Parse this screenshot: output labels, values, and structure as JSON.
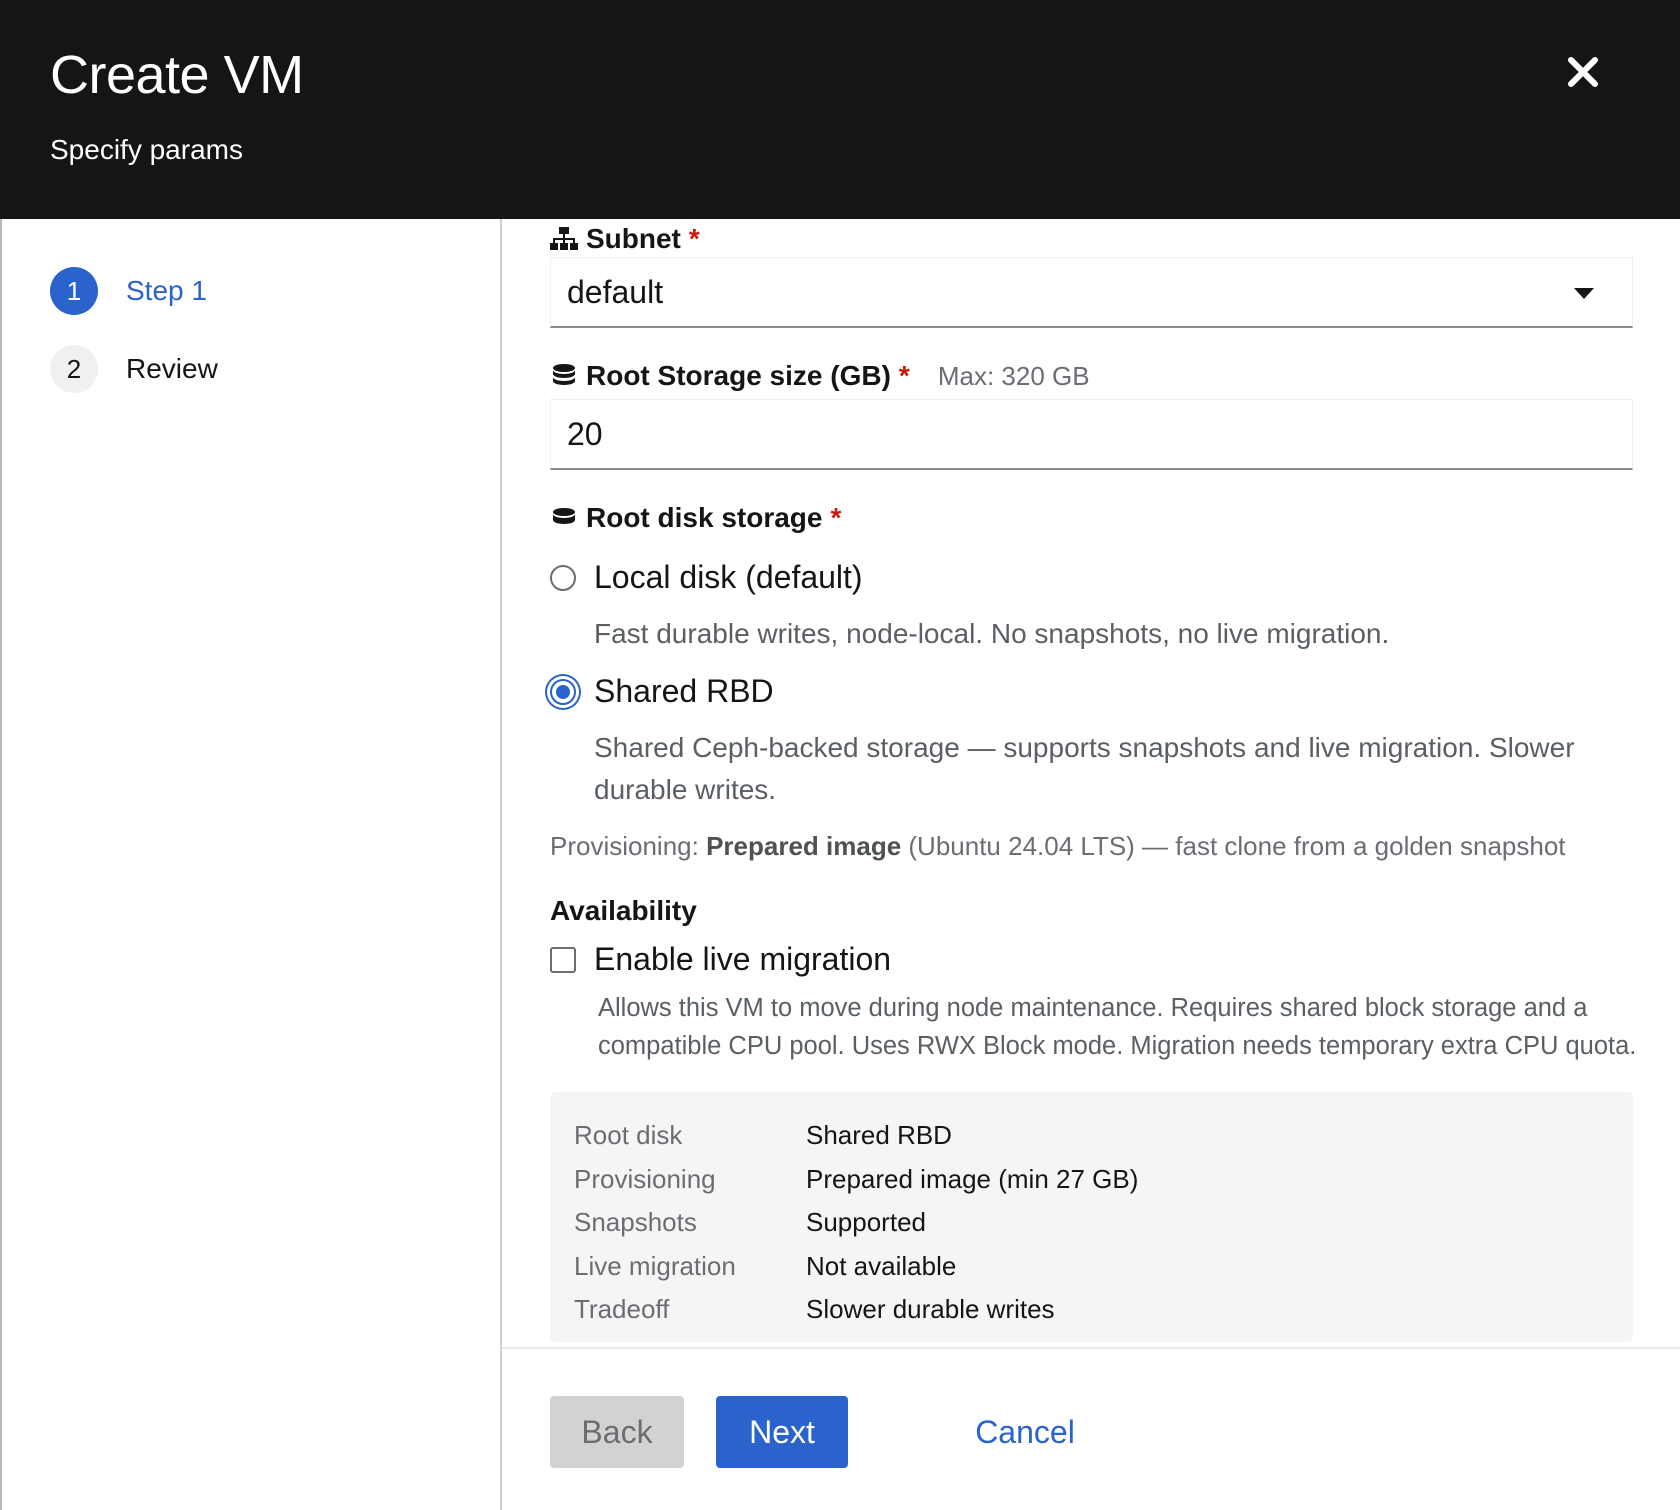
{
  "header": {
    "title": "Create VM",
    "subtitle": "Specify params",
    "close_icon": "close-icon"
  },
  "wizard_nav": {
    "steps": [
      {
        "number": "1",
        "label": "Step 1",
        "state": "active"
      },
      {
        "number": "2",
        "label": "Review",
        "state": "idle"
      }
    ]
  },
  "form": {
    "subnet": {
      "label": "Subnet",
      "required_mark": "*",
      "icon": "network-icon",
      "value": "default"
    },
    "root_storage_size": {
      "label": "Root Storage size (GB)",
      "required_mark": "*",
      "hint": "Max: 320 GB",
      "icon": "database-icon",
      "value": "20"
    },
    "root_disk_storage": {
      "label": "Root disk storage",
      "required_mark": "*",
      "icon": "disk-icon",
      "options": [
        {
          "label": "Local disk (default)",
          "description": "Fast durable writes, node-local. No snapshots, no live migration.",
          "checked": false
        },
        {
          "label": "Shared RBD",
          "description": "Shared Ceph-backed storage — supports snapshots and live migration. Slower durable writes.",
          "checked": true
        }
      ]
    },
    "provisioning": {
      "prefix": "Provisioning: ",
      "strong": "Prepared image",
      "suffix": " (Ubuntu 24.04 LTS) — fast clone from a golden snapshot"
    },
    "availability": {
      "heading": "Availability",
      "live_migration_label": "Enable live migration",
      "live_migration_checked": false,
      "live_migration_description": "Allows this VM to move during node maintenance. Requires shared block storage and a compatible CPU pool. Uses RWX Block mode. Migration needs temporary extra CPU quota."
    },
    "summary": [
      {
        "key": "Root disk",
        "value": "Shared RBD"
      },
      {
        "key": "Provisioning",
        "value": "Prepared image (min 27 GB)"
      },
      {
        "key": "Snapshots",
        "value": "Supported"
      },
      {
        "key": "Live migration",
        "value": "Not available"
      },
      {
        "key": "Tradeoff",
        "value": "Slower durable writes"
      }
    ]
  },
  "footer": {
    "back_label": "Back",
    "next_label": "Next",
    "cancel_label": "Cancel"
  },
  "colors": {
    "header_bg": "#151515",
    "accent": "#2b63cc",
    "required": "#c9190b",
    "summary_bg": "#f5f5f5"
  }
}
